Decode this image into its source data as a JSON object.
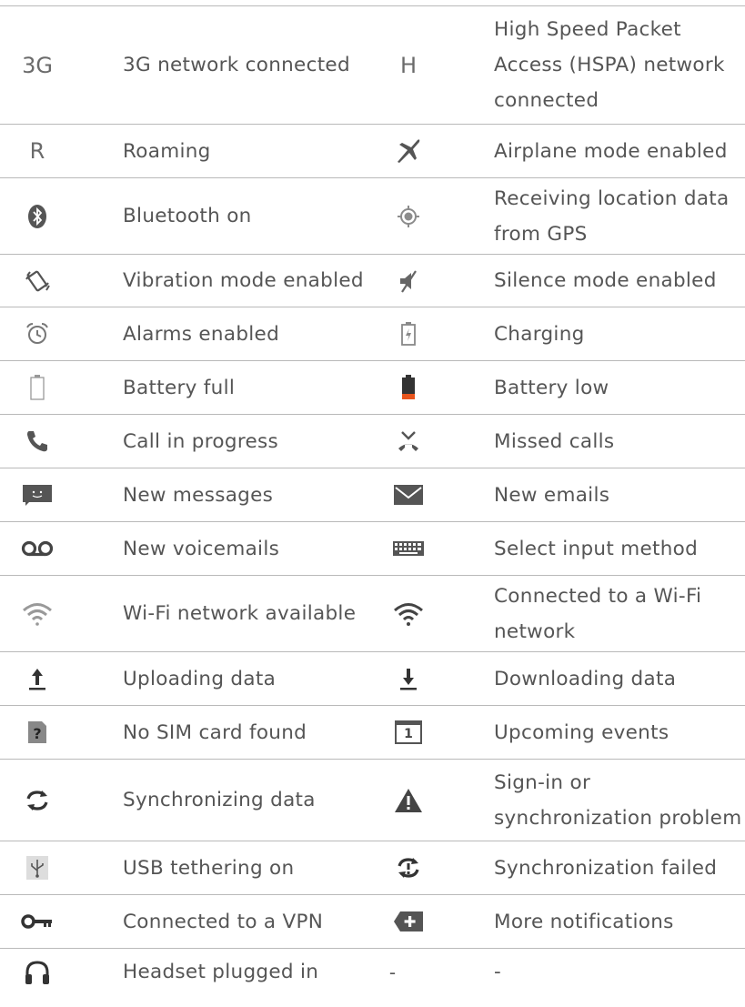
{
  "rows": [
    {
      "left": {
        "icon": "3g-icon",
        "glyph": "3G",
        "label": "3G network connected"
      },
      "right": {
        "icon": "hspa-icon",
        "glyph": "H",
        "label": "High Speed Packet Access (HSPA) network connected"
      }
    },
    {
      "left": {
        "icon": "roaming-icon",
        "glyph": "R",
        "label": "Roaming"
      },
      "right": {
        "icon": "airplane-icon",
        "label": "Airplane mode enabled"
      }
    },
    {
      "left": {
        "icon": "bluetooth-icon",
        "label": "Bluetooth on"
      },
      "right": {
        "icon": "gps-icon",
        "label": "Receiving location data from GPS"
      }
    },
    {
      "left": {
        "icon": "vibration-icon",
        "label": "Vibration mode enabled"
      },
      "right": {
        "icon": "silent-icon",
        "label": "Silence mode enabled"
      }
    },
    {
      "left": {
        "icon": "alarm-icon",
        "label": "Alarms enabled"
      },
      "right": {
        "icon": "charging-icon",
        "label": "Charging"
      }
    },
    {
      "left": {
        "icon": "battery-full-icon",
        "label": "Battery full"
      },
      "right": {
        "icon": "battery-low-icon",
        "label": "Battery low"
      }
    },
    {
      "left": {
        "icon": "phone-call-icon",
        "label": "Call in progress"
      },
      "right": {
        "icon": "missed-call-icon",
        "label": "Missed calls"
      }
    },
    {
      "left": {
        "icon": "message-icon",
        "label": "New messages"
      },
      "right": {
        "icon": "email-icon",
        "label": "New emails"
      }
    },
    {
      "left": {
        "icon": "voicemail-icon",
        "label": "New voicemails"
      },
      "right": {
        "icon": "keyboard-icon",
        "label": "Select input method"
      }
    },
    {
      "left": {
        "icon": "wifi-available-icon",
        "label": "Wi-Fi network available"
      },
      "right": {
        "icon": "wifi-connected-icon",
        "label": "Connected to a Wi-Fi network"
      }
    },
    {
      "left": {
        "icon": "upload-icon",
        "label": "Uploading data"
      },
      "right": {
        "icon": "download-icon",
        "label": "Downloading data"
      }
    },
    {
      "left": {
        "icon": "no-sim-icon",
        "label": "No SIM card found"
      },
      "right": {
        "icon": "calendar-icon",
        "glyph": "1",
        "label": "Upcoming events"
      }
    },
    {
      "left": {
        "icon": "sync-icon",
        "label": "Synchronizing data"
      },
      "right": {
        "icon": "warning-icon",
        "label": "Sign-in or synchronization problem"
      }
    },
    {
      "left": {
        "icon": "usb-icon",
        "label": "USB tethering on"
      },
      "right": {
        "icon": "sync-failed-icon",
        "label": "Synchronization failed"
      }
    },
    {
      "left": {
        "icon": "vpn-key-icon",
        "label": "Connected to a VPN"
      },
      "right": {
        "icon": "more-notifications-icon",
        "label": "More notifications"
      }
    },
    {
      "left": {
        "icon": "headset-icon",
        "label": "Headset plugged in"
      },
      "right": {
        "icon": "none",
        "dash": "-",
        "label": "-"
      }
    }
  ],
  "colors": {
    "icon": "#6d6d6d",
    "rule": "#b9b9b9",
    "battery_low": "#e8541c",
    "text": "#555555"
  }
}
